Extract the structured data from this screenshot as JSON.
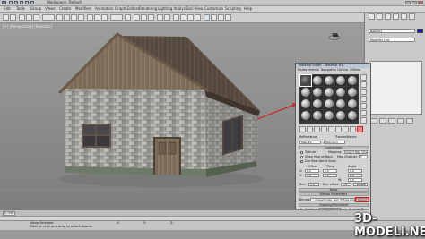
{
  "window": {
    "title": "Workspace: Default"
  },
  "menu": {
    "items": [
      "Edit",
      "Tools",
      "Group",
      "Views",
      "Create",
      "Modifiers",
      "Animation",
      "Graph Editors",
      "Rendering",
      "Lighting Analysis",
      "Civil View",
      "Customize",
      "Scripting",
      "Help"
    ]
  },
  "viewport": {
    "label": "[+] [Perspective] [Realistic]"
  },
  "command_panel": {
    "object_name": "Box001",
    "modifier_list_label": "Modifier List",
    "color": "#1a1aa6"
  },
  "material_editor": {
    "title": "Material Editor - Material #1",
    "menu": [
      "Modes",
      "Material",
      "Navigation",
      "Options",
      "Utilities"
    ],
    "material_name": "Material #1",
    "material_type": "Standard",
    "rollouts": [
      "Coordinates",
      "Noise",
      "Bitmap Parameters",
      "Cropping/Placement",
      "Output"
    ],
    "shading": "Blinn",
    "reflectance_label": "Reflectance",
    "transmittance_label": "Transmittance",
    "map_name": "Map #1",
    "bitmap_label": "Bitmap:",
    "bitmap_path": "...\\maps\\house_wall_diffuse.jpg",
    "reload_label": "Reload",
    "apply_label": "Apply",
    "view_image_label": "View Image",
    "texture_label": "Texture",
    "mapping_label": "Mapping:",
    "mapping_value": "Explicit Map Channel",
    "map_channel_label": "Map Channel:",
    "map_channel_value": "1",
    "use_real_world_label": "Use Real-World Scale",
    "show_map_label": "Show Map on Back",
    "offset_label": "Offset",
    "tiling_label": "Tiling",
    "angle_label": "Angle",
    "u_label": "U:",
    "v_label": "V:",
    "w_label": "W:",
    "blur_label": "Blur:",
    "blur_value": "1.0",
    "blur_offset_label": "Blur offset:",
    "blur_offset_value": "0.0",
    "u_offset": "0.0",
    "v_offset": "0.0",
    "u_tiling": "1.0",
    "v_tiling": "1.0",
    "angle_u": "0.0",
    "angle_v": "0.0",
    "angle_w": "0.0",
    "rotate_label": "Rotate",
    "crop_label": "Crop",
    "place_label": "Place",
    "filtering_label": "Filtering",
    "pyramidal_label": "Pyramidal",
    "summed_area_label": "Summed Area",
    "none_label": "None"
  },
  "timeline": {
    "frame": "0 / 100"
  },
  "status": {
    "selection": "None Selected",
    "hint": "Click or click-and-drag to select objects",
    "x_label": "X:",
    "y_label": "Y:",
    "z_label": "Z:"
  },
  "watermark": "3D-MODELI.NET"
}
